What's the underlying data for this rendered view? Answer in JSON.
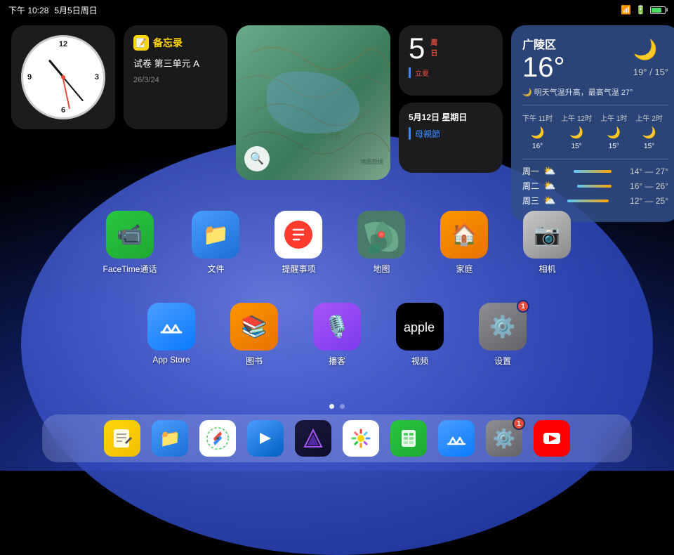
{
  "statusbar": {
    "time": "下午 10:28",
    "date": "5月5日周日",
    "wifi": "wifi",
    "signal": "signal",
    "battery": "battery"
  },
  "widgets": {
    "clock": {
      "label": "时钟"
    },
    "notes": {
      "app_label": "备忘录",
      "content": "试卷 第三单元\nA",
      "date": "26/3/24"
    },
    "map": {
      "search_icon": "🔍"
    },
    "calendar": {
      "day_number": "5",
      "day_name": "周\n日",
      "solar_term": "立夏"
    },
    "events": {
      "date": "5月12日 星期日",
      "items": [
        "母親節"
      ]
    },
    "weather": {
      "location": "广陵区",
      "current_temp": "16°",
      "range": "19° / 15°",
      "description": "🌙 明天气温升高，最高气温 27°",
      "hourly": [
        {
          "time": "下午 11时",
          "icon": "🌙",
          "temp": "16°"
        },
        {
          "time": "上午 12时",
          "icon": "🌙",
          "temp": "15°"
        },
        {
          "time": "上午 1时",
          "icon": "🌙",
          "temp": "15°"
        },
        {
          "time": "上午 2时",
          "icon": "🌙",
          "temp": "15°"
        }
      ],
      "forecast": [
        {
          "day": "周一",
          "icon": "⛅",
          "low": "14°",
          "high": "27°"
        },
        {
          "day": "周二",
          "icon": "⛅",
          "low": "16°",
          "high": "26°"
        },
        {
          "day": "周三",
          "icon": "⛅",
          "low": "12°",
          "high": "25°"
        }
      ]
    }
  },
  "apps_row1": [
    {
      "id": "facetime",
      "label": "FaceTime通话",
      "bg": "bg-facetime",
      "icon": "📹"
    },
    {
      "id": "files",
      "label": "文件",
      "bg": "bg-files",
      "icon": "📁"
    },
    {
      "id": "reminders",
      "label": "提醒事项",
      "bg": "bg-reminders",
      "icon": "📋"
    },
    {
      "id": "maps",
      "label": "地图",
      "bg": "bg-maps",
      "icon": "🗺️"
    },
    {
      "id": "home",
      "label": "家庭",
      "bg": "bg-home",
      "icon": "🏠"
    },
    {
      "id": "camera",
      "label": "相机",
      "bg": "bg-camera",
      "icon": "📷"
    }
  ],
  "apps_row2": [
    {
      "id": "appstore",
      "label": "App Store",
      "bg": "bg-appstore",
      "icon": "App",
      "badge": null
    },
    {
      "id": "books",
      "label": "图书",
      "bg": "bg-books",
      "icon": "📚"
    },
    {
      "id": "podcasts",
      "label": "播客",
      "bg": "bg-podcasts",
      "icon": "🎙️"
    },
    {
      "id": "tv",
      "label": "视频",
      "bg": "bg-tv",
      "icon": "tv",
      "badge": null
    },
    {
      "id": "settings",
      "label": "设置",
      "bg": "bg-settings",
      "icon": "⚙️",
      "badge": "1"
    }
  ],
  "page_dots": [
    {
      "active": true
    },
    {
      "active": false
    }
  ],
  "dock": [
    {
      "id": "notes-dock",
      "label": "备忘录",
      "bg": "bg-notes",
      "icon": "📝"
    },
    {
      "id": "files-dock",
      "label": "文件",
      "bg": "bg-files",
      "icon": "📁"
    },
    {
      "id": "safari-dock",
      "label": "Safari",
      "bg": "bg-safari",
      "icon": "🧭"
    },
    {
      "id": "prompt-dock",
      "label": "Prompt",
      "bg": "bg-prompt",
      "icon": "➤"
    },
    {
      "id": "notchmeister-dock",
      "label": "Notchmeister",
      "bg": "bg-notchmeister",
      "icon": "💎"
    },
    {
      "id": "photos-dock",
      "label": "照片",
      "bg": "bg-photos",
      "icon": "🌸"
    },
    {
      "id": "numbers-dock",
      "label": "Numbers",
      "bg": "bg-numbers",
      "icon": "📊"
    },
    {
      "id": "appstore-dock",
      "label": "App Store",
      "bg": "bg-appstore",
      "icon": "A"
    },
    {
      "id": "settings-dock",
      "label": "设置",
      "bg": "bg-settings",
      "icon": "⚙️",
      "badge": "1"
    },
    {
      "id": "youtube-dock",
      "label": "YouTube",
      "bg": "bg-youtube",
      "icon": "▶"
    }
  ]
}
